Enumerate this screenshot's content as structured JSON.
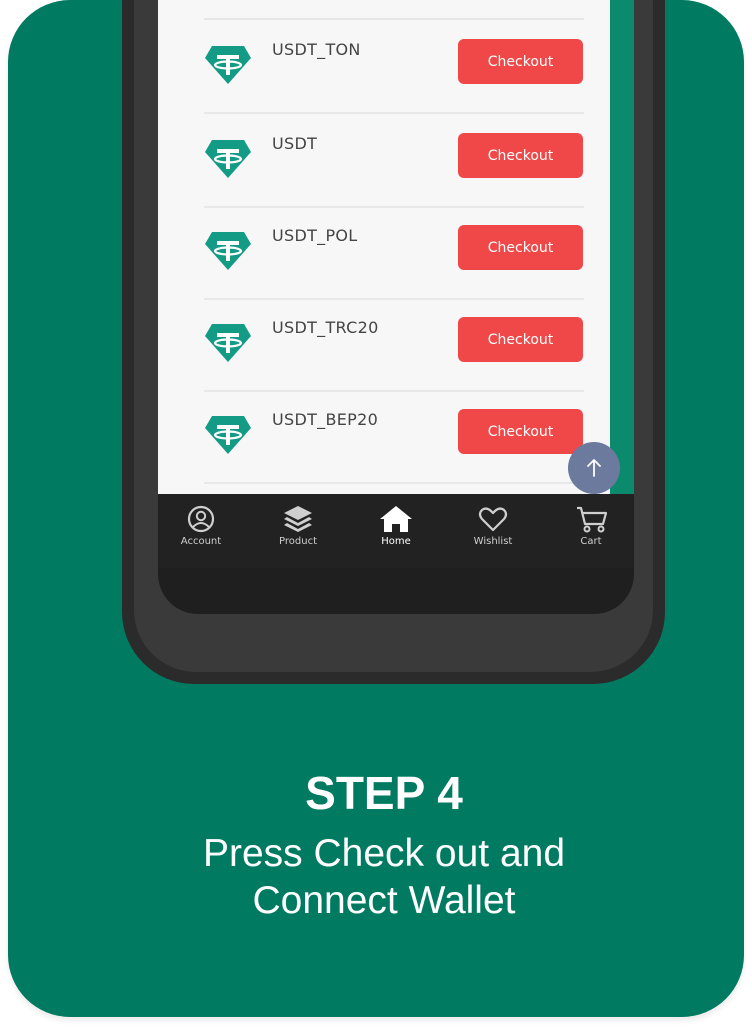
{
  "coins": [
    {
      "name": "USDT_TON",
      "button": "Checkout"
    },
    {
      "name": "USDT",
      "button": "Checkout"
    },
    {
      "name": "USDT_POL",
      "button": "Checkout"
    },
    {
      "name": "USDT_TRC20",
      "button": "Checkout"
    },
    {
      "name": "USDT_BEP20",
      "button": "Checkout"
    }
  ],
  "nav": {
    "account": "Account",
    "product": "Product",
    "home": "Home",
    "wishlist": "Wishlist",
    "cart": "Cart"
  },
  "caption": {
    "step": "STEP 4",
    "line1": "Press Check out and",
    "line2": "Connect Wallet"
  },
  "colors": {
    "background": "#017a62",
    "button": "#f04848",
    "coin_icon": "#139b86"
  }
}
